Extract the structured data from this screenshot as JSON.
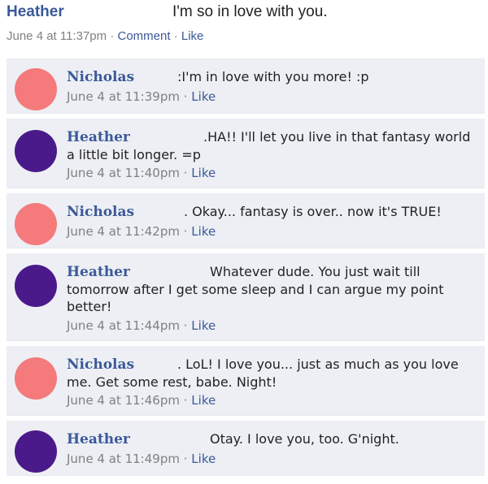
{
  "post": {
    "author": "Heather",
    "text": "I'm so in love with you.",
    "time": "June 4 at 11:37pm",
    "comment_label": "Comment",
    "like_label": "Like",
    "separator": "·"
  },
  "comments": [
    {
      "author": "Nicholas",
      "text": ":I'm in love with you more! :p",
      "time": "June 4 at 11:39pm",
      "like": "Like",
      "avatar_color": "#f47a7c"
    },
    {
      "author": "Heather",
      "text": ".HA!! I'll let you live in that fantasy world a little bit longer. =p",
      "time": "June 4 at 11:40pm",
      "like": "Like",
      "avatar_color": "#4b1a8a"
    },
    {
      "author": "Nicholas",
      "text": ". Okay... fantasy is over.. now it's TRUE!",
      "time": "June 4 at 11:42pm",
      "like": "Like",
      "avatar_color": "#f47a7c"
    },
    {
      "author": "Heather",
      "text": "Whatever dude. You just wait till tomorrow after I get some sleep and I can argue my point better!",
      "time": "June 4 at 11:44pm",
      "like": "Like",
      "avatar_color": "#4b1a8a"
    },
    {
      "author": "Nicholas",
      "text": ". LoL! I love you... just as much as you love me. Get some rest, babe. Night!",
      "time": "June 4 at 11:46pm",
      "like": "Like",
      "avatar_color": "#f47a7c"
    },
    {
      "author": "Heather",
      "text": "Otay. I love you, too. G'night.",
      "time": "June 4 at 11:49pm",
      "like": "Like",
      "avatar_color": "#4b1a8a"
    }
  ]
}
